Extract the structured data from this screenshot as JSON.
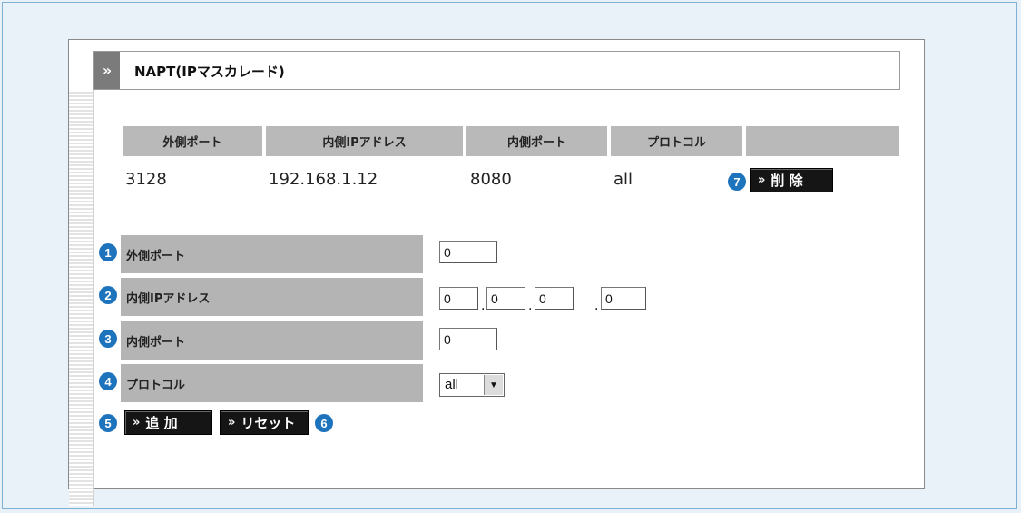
{
  "title": "NAPT(IPマスカレード)",
  "title_marker": "»",
  "table": {
    "headers": [
      "外側ポート",
      "内側IPアドレス",
      "内側ポート",
      "プロトコル",
      ""
    ],
    "rows": [
      {
        "external_port": "3128",
        "internal_ip": "192.168.1.12",
        "internal_port": "8080",
        "protocol": "all",
        "delete_label": "削除"
      }
    ]
  },
  "form": {
    "external_port": {
      "label": "外側ポート",
      "value": "0"
    },
    "internal_ip": {
      "label": "内側IPアドレス",
      "octets": [
        "0",
        "0",
        "0",
        "0"
      ]
    },
    "internal_port": {
      "label": "内側ポート",
      "value": "0"
    },
    "protocol": {
      "label": "プロトコル",
      "selected": "all"
    }
  },
  "buttons": {
    "chevron": "»",
    "add": "追 加",
    "reset": "リセット",
    "delete": "削 除"
  },
  "badges": [
    "1",
    "2",
    "3",
    "4",
    "5",
    "6",
    "7"
  ],
  "colors": {
    "badge": "#1e73bd",
    "header": "#b9b9b9",
    "button": "#151515"
  }
}
